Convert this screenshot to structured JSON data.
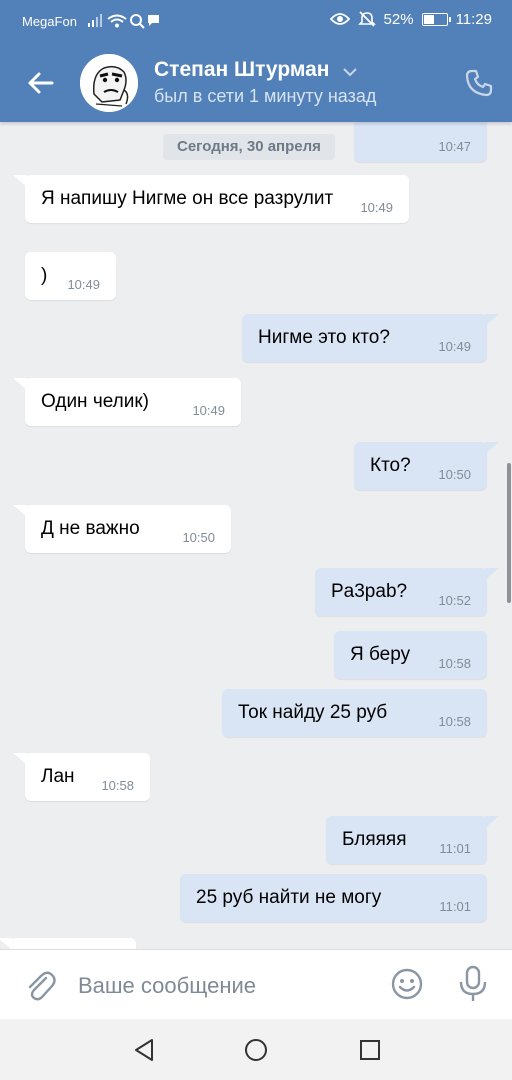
{
  "status_bar": {
    "carrier": "MegaFon",
    "battery": "52%",
    "battery_level": 0.52,
    "time": "11:29"
  },
  "header": {
    "name": "Степан Штурман",
    "status": "был в сети 1 минуту назад"
  },
  "chat": {
    "date_separator": "Сегодня, 30 апреля",
    "top_partial_time": "10:47",
    "messages": [
      {
        "dir": "in",
        "text": "Я напишу Нигме он все разрулит",
        "time": "10:49"
      },
      {
        "dir": "in",
        "text": ")",
        "time": "10:49"
      },
      {
        "dir": "out",
        "text": "Нигме это кто?",
        "time": "10:49"
      },
      {
        "dir": "in",
        "text": "Один челик)",
        "time": "10:49"
      },
      {
        "dir": "out",
        "text": "Кто?",
        "time": "10:50"
      },
      {
        "dir": "in",
        "text": "Д не важно",
        "time": "10:50"
      },
      {
        "dir": "out",
        "text": "Pa3pab?",
        "time": "10:52"
      },
      {
        "dir": "out",
        "text": "Я беру",
        "time": "10:58"
      },
      {
        "dir": "out",
        "text": "Ток найду 25 руб",
        "time": "10:58"
      },
      {
        "dir": "in",
        "text": "Лан",
        "time": "10:58"
      },
      {
        "dir": "out",
        "text": "Бляяяя",
        "time": "11:01"
      },
      {
        "dir": "out",
        "text": "25 руб найти не могу",
        "time": "11:01"
      }
    ]
  },
  "composer": {
    "placeholder": "Ваше сообщение"
  },
  "icons": {
    "back": "arrow-left-icon",
    "call": "phone-icon",
    "attach": "paperclip-icon",
    "emoji": "smiley-icon",
    "mic": "microphone-icon",
    "nav_back": "triangle-back-icon",
    "nav_home": "circle-home-icon",
    "nav_recent": "square-recent-icon"
  },
  "colors": {
    "brand": "#5181b8",
    "incoming_bubble": "#ffffff",
    "outgoing_bubble": "#d9e5f5",
    "chat_background": "#edeef0"
  }
}
